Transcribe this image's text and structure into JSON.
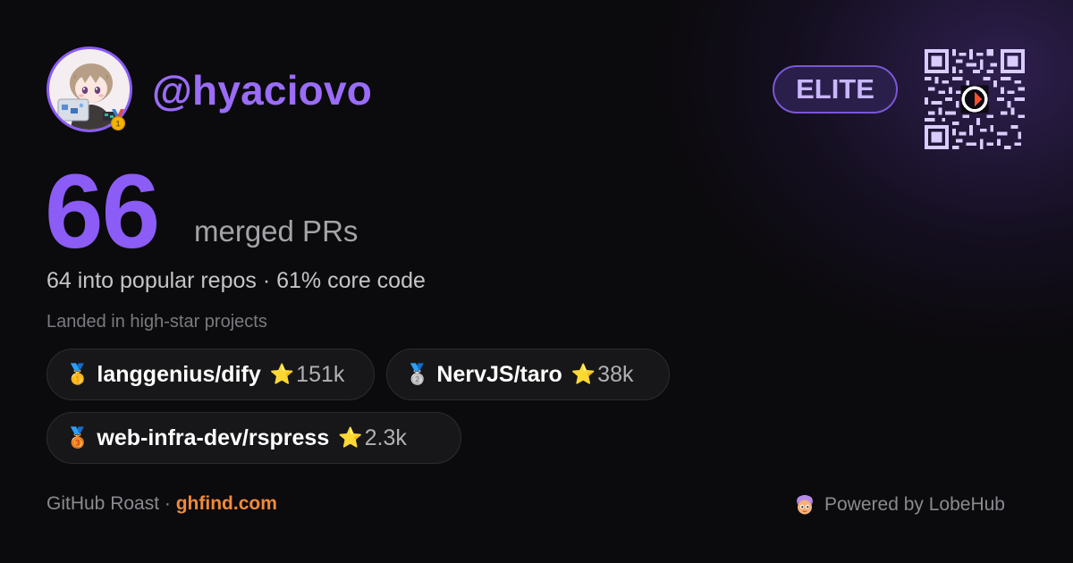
{
  "profile": {
    "handle": "@hyaciovo",
    "avatar_icon": "user-avatar-illustration",
    "badge_icon": "gold-medal-icon"
  },
  "tier": {
    "label": "ELITE"
  },
  "qr": {
    "icon": "qr-code-icon"
  },
  "stats": {
    "merged_count": "66",
    "merged_label": "merged PRs",
    "subline": "64 into popular repos · 61% core code"
  },
  "repos": {
    "section_label": "Landed in high-star projects",
    "items": [
      {
        "medal": "🥇",
        "name": "langgenius/dify",
        "star": "⭐",
        "stars": "151k"
      },
      {
        "medal": "🥈",
        "name": "NervJS/taro",
        "star": "⭐",
        "stars": "38k"
      },
      {
        "medal": "🥉",
        "name": "web-infra-dev/rspress",
        "star": "⭐",
        "stars": "2.3k"
      }
    ]
  },
  "footer": {
    "left_prefix": "GitHub Roast · ",
    "site": "ghfind.com",
    "powered_by": "Powered by LobeHub",
    "powered_icon": "lobehub-icon"
  },
  "colors": {
    "accent": "#8b5cf6",
    "background": "#0b0a0c",
    "site_link": "#f08a3a",
    "star": "#f5b400"
  }
}
